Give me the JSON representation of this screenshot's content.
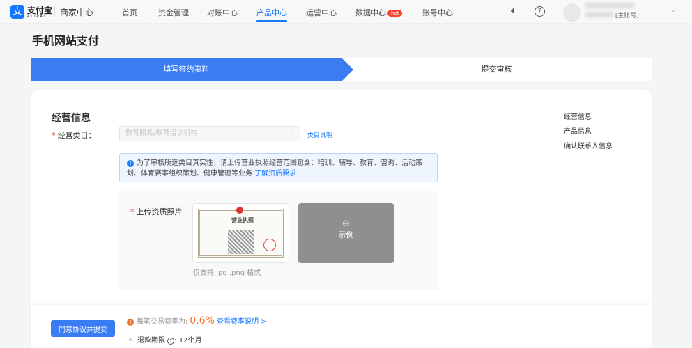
{
  "nav": {
    "logo_icon": "alipay-logo",
    "brand": "支付宝",
    "brand_sub": "ALIPAY",
    "center": "商家中心",
    "items": [
      {
        "label": "首页"
      },
      {
        "label": "资金管理"
      },
      {
        "label": "对账中心"
      },
      {
        "label": "产品中心",
        "active": true
      },
      {
        "label": "运营中心"
      },
      {
        "label": "数据中心",
        "badge": "hot"
      },
      {
        "label": "账号中心"
      }
    ],
    "account_role": "[主账号]"
  },
  "page_title": "手机网站支付",
  "steps": [
    "填写签约资料",
    "提交审核"
  ],
  "form": {
    "section": "经营信息",
    "category_label": "经营类目：",
    "category_value": "教育服务/教育培训机构",
    "category_link": "类目说明",
    "alert_text": "为了审核所选类目真实性，请上传营业执照经营范围包含：培训、辅导、教育、咨询、活动策划、体育赛事组织策划、健康管理等业务",
    "alert_link": "了解资质要求",
    "upload_label": "上传资质照片",
    "license_title": "营业执照",
    "sample_label": "示例",
    "format_hint": "仅支持.jpg .png 格式"
  },
  "anchors": [
    "经营信息",
    "产品信息",
    "确认联系人信息"
  ],
  "footer": {
    "submit": "同意协议并提交",
    "fee_label": "每笔交易费率为:",
    "fee_rate": "0.6%",
    "fee_link": "查看费率说明 >",
    "refund_label": "退款期限",
    "refund_value": ": 12个月"
  }
}
